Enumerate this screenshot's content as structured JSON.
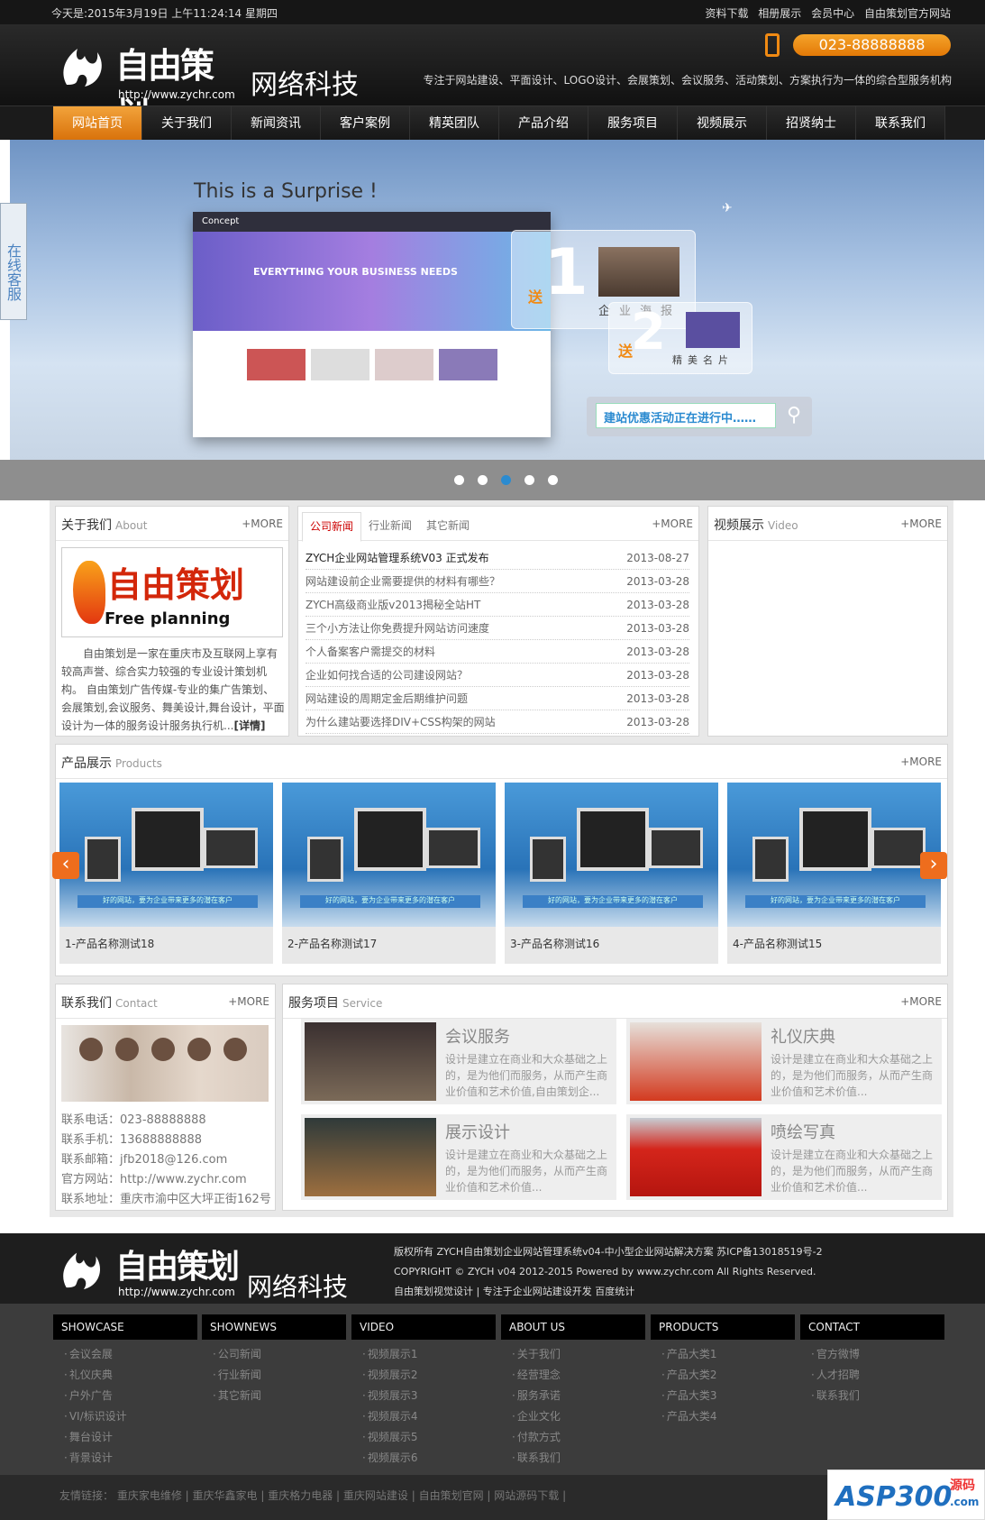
{
  "topbar": {
    "date": "今天是:2015年3月19日 上午11:24:14 星期四",
    "links": [
      "资料下载",
      "相册展示",
      "会员中心",
      "自由策划官方网站"
    ]
  },
  "header": {
    "logo_cn": "自由策划",
    "logo_url": "http://www.zychr.com",
    "brand": "网络科技",
    "phone": "023-88888888",
    "slogan": "专注于网站建设、平面设计、LOGO设计、会展策划、会议服务、活动策划、方案执行为一体的综合型服务机构",
    "accent_color": "#e8820f"
  },
  "nav": [
    "网站首页",
    "关于我们",
    "新闻资讯",
    "客户案例",
    "精英团队",
    "产品介绍",
    "服务项目",
    "视频展示",
    "招贤纳士",
    "联系我们"
  ],
  "banner": {
    "headline": "This is a Surprise !",
    "mock_brand": "Concept",
    "mock_hero": "EVERYTHING YOUR BUSINESS NEEDS",
    "gift1_send": "送",
    "gift1_num": "1",
    "gift1_text": "企业海报",
    "gift2_send": "送",
    "gift2_num": "2",
    "gift2_text": "精美名片",
    "promo": "建站优惠活动正在进行中……",
    "kefu": "在线客服",
    "slides": 5,
    "active_slide": 3
  },
  "about": {
    "title": "关于我们",
    "sub": "About",
    "more": "+MORE",
    "img_cn": "自由策划",
    "img_en": "Free planning",
    "text": "自由策划是一家在重庆市及互联网上享有较高声誉、综合实力较强的专业设计策划机构。 自由策划广告传媒-专业的集广告策划、会展策划,会议服务、舞美设计,舞台设计，平面设计为一体的服务设计服务执行机...",
    "detail": "[详情]"
  },
  "news": {
    "tabs": [
      "公司新闻",
      "行业新闻",
      "其它新闻"
    ],
    "more": "+MORE",
    "items": [
      {
        "title": "ZYCH企业网站管理系统V03 正式发布",
        "date": "2013-08-27"
      },
      {
        "title": "网站建设前企业需要提供的材料有哪些？",
        "date": "2013-03-28"
      },
      {
        "title": "ZYCH高级商业版v2013揭秘全站HT",
        "date": "2013-03-28"
      },
      {
        "title": "三个小方法让你免费提升网站访问速度",
        "date": "2013-03-28"
      },
      {
        "title": "个人备案客户需提交的材料",
        "date": "2013-03-28"
      },
      {
        "title": "企业如何找合适的公司建设网站？",
        "date": "2013-03-28"
      },
      {
        "title": "网站建设的周期定金后期维护问题",
        "date": "2013-03-28"
      },
      {
        "title": "为什么建站要选择DIV+CSS构架的网站",
        "date": "2013-03-28"
      }
    ]
  },
  "video": {
    "title": "视频展示",
    "sub": "Video",
    "more": "+MORE"
  },
  "products": {
    "title": "产品展示",
    "sub": "Products",
    "more": "+MORE",
    "items": [
      "1-产品名称测试18",
      "2-产品名称测试17",
      "3-产品名称测试16",
      "4-产品名称测试15"
    ],
    "prev": "‹",
    "next": "›",
    "ribbon": "好的网站，要为企业带来更多的潜在客户"
  },
  "contact": {
    "title": "联系我们",
    "sub": "Contact",
    "more": "+MORE",
    "rows": [
      "联系电话：023-88888888",
      "联系手机：13688888888",
      "联系邮箱：jfb2018@126.com",
      "官方网站：http://www.zychr.com",
      "联系地址：重庆市渝中区大坪正街162号"
    ]
  },
  "service": {
    "title": "服务项目",
    "sub": "Service",
    "more": "+MORE",
    "items": [
      {
        "title": "会议服务",
        "desc": "设计是建立在商业和大众基础之上的，是为他们而服务，从而产生商业价值和艺术价值,自由策划企..."
      },
      {
        "title": "礼仪庆典",
        "desc": "设计是建立在商业和大众基础之上的，是为他们而服务，从而产生商业价值和艺术价值..."
      },
      {
        "title": "展示设计",
        "desc": "设计是建立在商业和大众基础之上的，是为他们而服务，从而产生商业价值和艺术价值..."
      },
      {
        "title": "喷绘写真",
        "desc": "设计是建立在商业和大众基础之上的，是为他们而服务，从而产生商业价值和艺术价值..."
      }
    ]
  },
  "footer": {
    "logo_cn": "自由策划",
    "logo_url": "http://www.zychr.com",
    "brand": "网络科技",
    "copy1": "版权所有 ZYCH自由策划企业网站管理系统v04-中小型企业网站解决方案 苏ICP备13018519号-2",
    "copy2": "COPYRIGHT © ZYCH v04 2012-2015 Powered by www.zychr.com All Rights Reserved.",
    "copy3": "自由策划视觉设计 | 专注于企业网站建设开发 百度统计"
  },
  "sitemap": [
    {
      "head": "SHOWCASE",
      "items": [
        "会议会展",
        "礼仪庆典",
        "户外广告",
        "VI/标识设计",
        "舞台设计",
        "背景设计"
      ]
    },
    {
      "head": "SHOWNEWS",
      "items": [
        "公司新闻",
        "行业新闻",
        "其它新闻"
      ]
    },
    {
      "head": "VIDEO",
      "items": [
        "视频展示1",
        "视频展示2",
        "视频展示3",
        "视频展示4",
        "视频展示5",
        "视频展示6"
      ]
    },
    {
      "head": "ABOUT US",
      "items": [
        "关于我们",
        "经营理念",
        "服务承诺",
        "企业文化",
        "付款方式",
        "联系我们"
      ]
    },
    {
      "head": "PRODUCTS",
      "items": [
        "产品大类1",
        "产品大类2",
        "产品大类3",
        "产品大类4"
      ]
    },
    {
      "head": "CONTACT",
      "items": [
        "官方微博",
        "人才招聘",
        "联系我们"
      ]
    }
  ],
  "friendlinks": {
    "label": "友情链接：",
    "items": [
      "重庆家电维修",
      "重庆华鑫家电",
      "重庆格力电器",
      "重庆网站建设",
      "自由策划官网",
      "网站源码下载"
    ]
  },
  "watermark": {
    "a": "ASP300",
    "b": "源码",
    "c": ".com"
  }
}
